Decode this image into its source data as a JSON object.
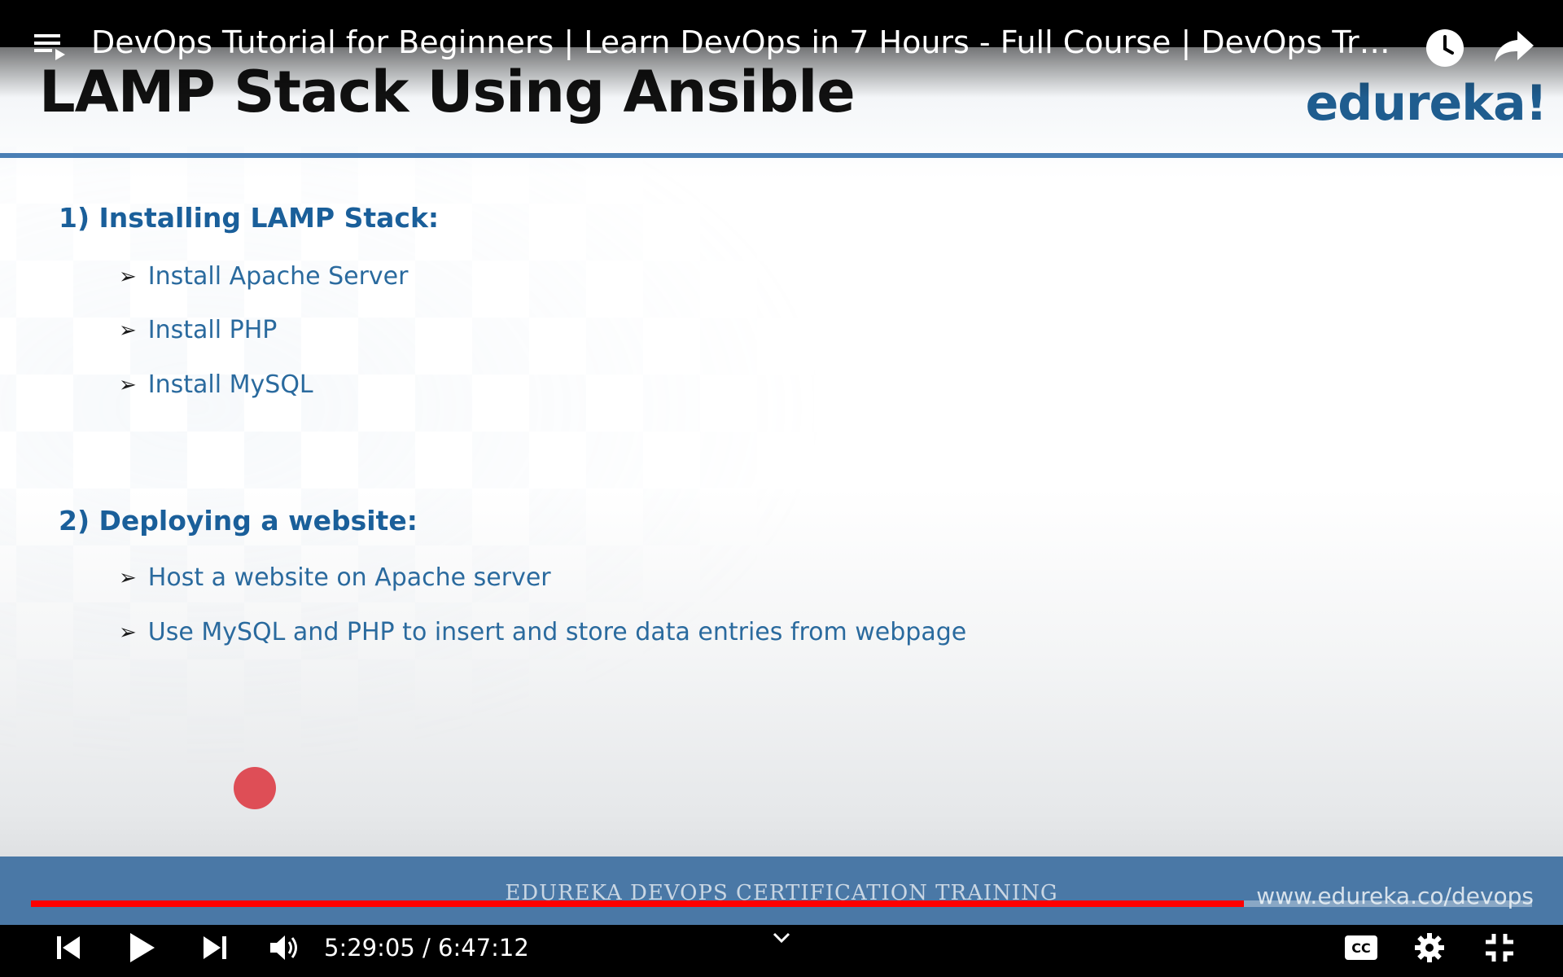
{
  "player": {
    "video_title": "DevOps Tutorial for Beginners | Learn DevOps in 7 Hours - Full Course | DevOps Traini…",
    "current_time": "5:29:05",
    "duration": "6:47:12",
    "time_separator": " / ",
    "progress_fraction": 0.808,
    "accent_color": "#ff0000",
    "icons": {
      "playlist": "playlist-icon",
      "watch_later": "clock-icon",
      "share": "share-icon",
      "previous": "skip-previous-icon",
      "play": "play-icon",
      "next": "skip-next-icon",
      "volume": "volume-icon",
      "chevron": "chevron-down-icon",
      "captions": "captions-icon",
      "settings": "gear-icon",
      "exit_fullscreen": "exit-fullscreen-icon"
    },
    "captions_label": "CC"
  },
  "slide": {
    "title": "LAMP Stack Using Ansible",
    "logo": "edureka!",
    "section1": {
      "heading": "1) Installing LAMP Stack:",
      "bullets": [
        "Install Apache Server",
        "Install PHP",
        "Install MySQL"
      ]
    },
    "section2": {
      "heading": "2) Deploying a website:",
      "bullets": [
        "Host a website on Apache server",
        "Use MySQL and PHP to insert and store data entries from webpage"
      ]
    },
    "footer_left": "EDUREKA DEVOPS CERTIFICATION TRAINING",
    "footer_right": "www.edureka.co/devops",
    "bullet_glyph": "➢",
    "brand_color": "#1f5d8f",
    "rule_color": "#4a7fb5"
  }
}
